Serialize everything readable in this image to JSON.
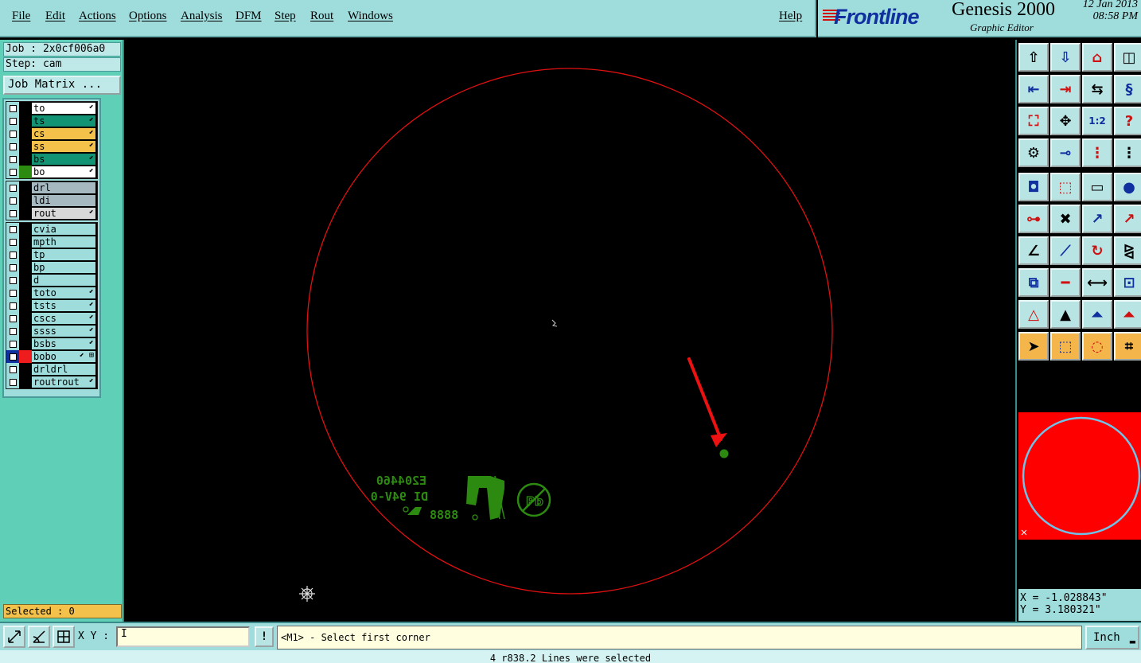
{
  "menu": [
    "File",
    "Edit",
    "Actions",
    "Options",
    "Analysis",
    "DFM",
    "Step",
    "Rout",
    "Windows"
  ],
  "help_label": "Help",
  "brand": {
    "logo": "Frontline",
    "product": "Genesis 2000",
    "subtitle": "Graphic Editor",
    "date": "12 Jan 2013",
    "time": "08:58 PM"
  },
  "job": {
    "job_label": "Job : 2x0cf006a0",
    "step_label": "Step: cam",
    "matrix_button": "Job Matrix ..."
  },
  "layer_groups": [
    [
      {
        "name": "to",
        "color": "#ffffff",
        "swatch": "#000000",
        "flag": "⬋"
      },
      {
        "name": "ts",
        "color": "#129474",
        "swatch": "#000000",
        "flag": "⬋"
      },
      {
        "name": "cs",
        "color": "#f4c24a",
        "swatch": "#000000",
        "flag": "⬋"
      },
      {
        "name": "ss",
        "color": "#f4c24a",
        "swatch": "#000000",
        "flag": "⬋"
      },
      {
        "name": "bs",
        "color": "#129474",
        "swatch": "#000000",
        "flag": "⬋"
      },
      {
        "name": "bo",
        "color": "#ffffff",
        "swatch": "#2d8a10",
        "flag": "⬋"
      }
    ],
    [
      {
        "name": "drl",
        "color": "#a6b8c0",
        "swatch": "#000000",
        "flag": ""
      },
      {
        "name": "ldi",
        "color": "#a6b8c0",
        "swatch": "#000000",
        "flag": ""
      },
      {
        "name": "rout",
        "color": "#d8d8d8",
        "swatch": "#000000",
        "flag": "⬋"
      }
    ],
    [
      {
        "name": "cvia",
        "color": "#9fdcdc",
        "swatch": "#000000",
        "flag": ""
      },
      {
        "name": "mpth",
        "color": "#9fdcdc",
        "swatch": "#000000",
        "flag": ""
      },
      {
        "name": "tp",
        "color": "#9fdcdc",
        "swatch": "#000000",
        "flag": ""
      },
      {
        "name": "bp",
        "color": "#9fdcdc",
        "swatch": "#000000",
        "flag": ""
      },
      {
        "name": "d",
        "color": "#9fdcdc",
        "swatch": "#000000",
        "flag": ""
      },
      {
        "name": "toto",
        "color": "#9fdcdc",
        "swatch": "#000000",
        "flag": "⬋"
      },
      {
        "name": "tsts",
        "color": "#9fdcdc",
        "swatch": "#000000",
        "flag": "⬋"
      },
      {
        "name": "cscs",
        "color": "#9fdcdc",
        "swatch": "#000000",
        "flag": "⬋"
      },
      {
        "name": "ssss",
        "color": "#9fdcdc",
        "swatch": "#000000",
        "flag": "⬋"
      },
      {
        "name": "bsbs",
        "color": "#9fdcdc",
        "swatch": "#000000",
        "flag": "⬋"
      },
      {
        "name": "bobo",
        "color": "#9fdcdc",
        "swatch": "#ee1c1c",
        "flag": "⬋ ⊞",
        "selected": true
      },
      {
        "name": "drldrl",
        "color": "#9fdcdc",
        "swatch": "#000000",
        "flag": ""
      },
      {
        "name": "routrout",
        "color": "#9fdcdc",
        "swatch": "#000000",
        "flag": "⬋"
      }
    ]
  ],
  "selected_label": "Selected : 0",
  "canvas": {
    "marking_text_1": "E204460",
    "marking_text_2": "DI 94V-0",
    "marking_text_3": "8888",
    "pb_symbol": "Pb",
    "colors": {
      "outline": "#e01010",
      "marking": "#2d8a10",
      "arrow": "#ee1111"
    }
  },
  "toolbar_icons": [
    "zoom-home-icon",
    "save-view-icon",
    "home-view-icon",
    "split-view-icon",
    "pan-left-icon",
    "pan-right-icon",
    "flip-icon",
    "snap-icon",
    "fit-screen-icon",
    "zoom-area-icon",
    "ratio-icon",
    "help-query-icon",
    "settings-icon",
    "measure-probe-icon",
    "net-icon",
    "net-select-icon",
    "draw-pad-icon",
    "draw-line-icon",
    "ruler-icon",
    "circle-pad-icon",
    "connect-icon",
    "delete-icon",
    "move-point-icon",
    "move-segment-icon",
    "angle-icon",
    "slope-icon",
    "rotate-icon",
    "mirror-icon",
    "copy-icon",
    "break-icon",
    "resize-icon",
    "group-icon",
    "arc-icon",
    "arc-up-icon",
    "arc-outline-icon",
    "arc-fill-icon",
    "select-icon",
    "select-box-icon",
    "select-round-icon",
    "select-net-icon"
  ],
  "coords": {
    "x": "X = -1.028843\"",
    "y": "Y = 3.180321\""
  },
  "bottom": {
    "xy_label": "X Y :",
    "xy_value": "I",
    "bang": "!",
    "prompt": "<M1> - Select first corner",
    "unit": "Inch"
  },
  "status": "4 r838.2 Lines were selected"
}
